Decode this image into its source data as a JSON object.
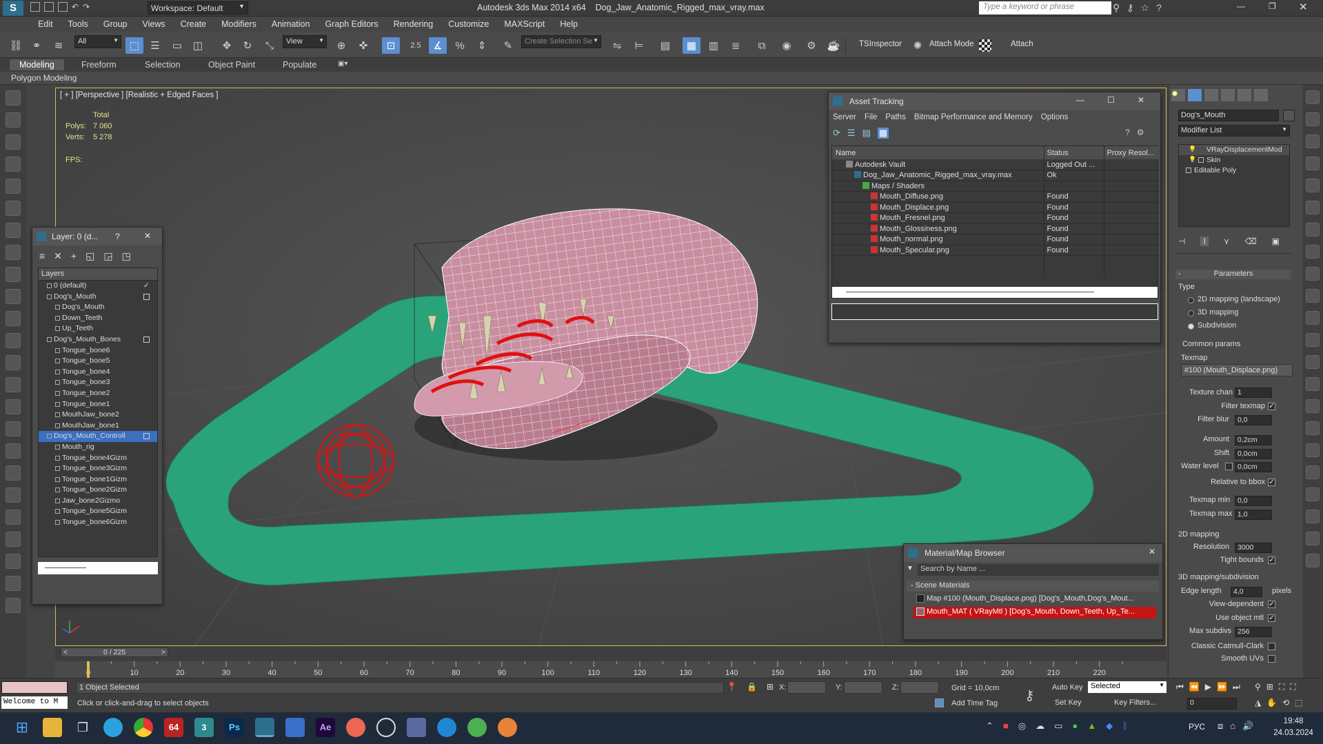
{
  "app": {
    "title": "Autodesk 3ds Max  2014 x64",
    "file": "Dog_Jaw_Anatomic_Rigged_max_vray.max",
    "workspace": "Workspace: Default",
    "search_placeholder": "Type a keyword or phrase"
  },
  "menu": [
    "Edit",
    "Tools",
    "Group",
    "Views",
    "Create",
    "Modifiers",
    "Animation",
    "Graph Editors",
    "Rendering",
    "Customize",
    "MAXScript",
    "Help"
  ],
  "toolbar": {
    "filter": "All",
    "refcoord": "View",
    "snap_value": "2.5",
    "selection_set_placeholder": "Create Selection Se",
    "tsinspector": "TSInspector",
    "attach_mode": "Attach Mode",
    "attach": "Attach"
  },
  "ribbon": {
    "tabs": [
      "Modeling",
      "Freeform",
      "Selection",
      "Object Paint",
      "Populate"
    ],
    "sub": "Polygon Modeling"
  },
  "viewport": {
    "label": "[ + ] [Perspective ] [Realistic + Edged Faces ]",
    "stats_header": "Total",
    "polys_label": "Polys:",
    "polys_value": "7 060",
    "verts_label": "Verts:",
    "verts_value": "5 278",
    "fps_label": "FPS:"
  },
  "layer_window": {
    "title": "Layer: 0 (d...",
    "help": "?",
    "header": "Layers",
    "items": [
      {
        "label": "0 (default)",
        "level": 0
      },
      {
        "label": "Dog's_Mouth",
        "level": 0
      },
      {
        "label": "Dog's_Mouth",
        "level": 1
      },
      {
        "label": "Down_Teeth",
        "level": 1
      },
      {
        "label": "Up_Teeth",
        "level": 1
      },
      {
        "label": "Dog's_Mouth_Bones",
        "level": 0
      },
      {
        "label": "Tongue_bone6",
        "level": 1
      },
      {
        "label": "Tongue_bone5",
        "level": 1
      },
      {
        "label": "Tongue_bone4",
        "level": 1
      },
      {
        "label": "Tongue_bone3",
        "level": 1
      },
      {
        "label": "Tongue_bone2",
        "level": 1
      },
      {
        "label": "Tongue_bone1",
        "level": 1
      },
      {
        "label": "MouthJaw_bone2",
        "level": 1
      },
      {
        "label": "MouthJaw_bone1",
        "level": 1
      },
      {
        "label": "Dog's_Mouth_Controll",
        "level": 0
      },
      {
        "label": "Mouth_rig",
        "level": 1
      },
      {
        "label": "Tongue_bone4Gizm",
        "level": 1
      },
      {
        "label": "Tongue_bone3Gizm",
        "level": 1
      },
      {
        "label": "Tongue_bone1Gizm",
        "level": 1
      },
      {
        "label": "Tongue_bone2Gizm",
        "level": 1
      },
      {
        "label": "Jaw_bone2Gizmo",
        "level": 1
      },
      {
        "label": "Tongue_bone5Gizm",
        "level": 1
      },
      {
        "label": "Tongue_bone6Gizm",
        "level": 1
      }
    ]
  },
  "asset_tracking": {
    "title": "Asset Tracking",
    "menu": [
      "Server",
      "File",
      "Paths",
      "Bitmap Performance and Memory",
      "Options"
    ],
    "columns": [
      "Name",
      "Status",
      "Proxy Resol..."
    ],
    "rows": [
      {
        "name": "Autodesk Vault",
        "status": "Logged Out ...",
        "indent": 1
      },
      {
        "name": "Dog_Jaw_Anatomic_Rigged_max_vray.max",
        "status": "Ok",
        "indent": 2
      },
      {
        "name": "Maps / Shaders",
        "status": "",
        "indent": 3
      },
      {
        "name": "Mouth_Diffuse.png",
        "status": "Found",
        "indent": 4
      },
      {
        "name": "Mouth_Displace.png",
        "status": "Found",
        "indent": 4
      },
      {
        "name": "Mouth_Fresnel.png",
        "status": "Found",
        "indent": 4
      },
      {
        "name": "Mouth_Glossiness.png",
        "status": "Found",
        "indent": 4
      },
      {
        "name": "Mouth_normal.png",
        "status": "Found",
        "indent": 4
      },
      {
        "name": "Mouth_Specular.png",
        "status": "Found",
        "indent": 4
      }
    ]
  },
  "material_browser": {
    "title": "Material/Map Browser",
    "search_placeholder": "Search by Name ...",
    "section": "- Scene Materials",
    "items": [
      "Map #100 (Mouth_Displace.png) [Dog's_Mouth,Dog's_Mout...",
      "Mouth_MAT  ( VRayMtl )  [Dog's_Mouth, Down_Teeth, Up_Te..."
    ]
  },
  "command_panel": {
    "object_name": "Dog's_Mouth",
    "modifier_list": "Modifier List",
    "stack": [
      "VRayDisplacementMod",
      "Skin",
      "Editable Poly"
    ],
    "rollout": "Parameters",
    "type_label": "Type",
    "type_options": [
      "2D mapping (landscape)",
      "3D mapping",
      "Subdivision"
    ],
    "common_params": "Common params",
    "texmap_label": "Texmap",
    "texmap_value": "#100 (Mouth_Displace.png)",
    "texture_chan_label": "Texture chan",
    "texture_chan": "1",
    "filter_texmap": "Filter texmap",
    "filter_blur_label": "Filter blur",
    "filter_blur": "0,0",
    "amount_label": "Amount",
    "amount": "0,2cm",
    "shift_label": "Shift",
    "shift": "0,0cm",
    "water_level_label": "Water level",
    "water_level": "0,0cm",
    "relative_bbox": "Relative to bbox",
    "texmap_min_label": "Texmap min",
    "texmap_min": "0,0",
    "texmap_max_label": "Texmap max",
    "texmap_max": "1,0",
    "mapping2d": "2D mapping",
    "resolution_label": "Resolution",
    "resolution": "3000",
    "tight_bounds": "Tight bounds",
    "mapping3d": "3D mapping/subdivision",
    "edge_length_label": "Edge length",
    "edge_length": "4,0",
    "pixels": "pixels",
    "view_dependent": "View-dependent",
    "use_object_mtl": "Use object mtl",
    "max_subdivs_label": "Max subdivs",
    "max_subdivs": "256",
    "classic_catmull": "Classic Catmull-Clark",
    "smooth_uvs": "Smooth UVs"
  },
  "timeline": {
    "frame": "0 / 225",
    "ticks": [
      "0",
      "10",
      "20",
      "30",
      "40",
      "50",
      "60",
      "70",
      "80",
      "90",
      "100",
      "110",
      "120",
      "130",
      "140",
      "150",
      "160",
      "170",
      "180",
      "190",
      "200",
      "210",
      "220"
    ]
  },
  "status": {
    "listener": "Welcome to M",
    "selected": "1 Object Selected",
    "prompt": "Click or click-and-drag to select objects",
    "x_label": "X:",
    "y_label": "Y:",
    "z_label": "Z:",
    "grid": "Grid = 10,0cm",
    "add_time_tag": "Add Time Tag",
    "auto_key": "Auto Key",
    "set_key": "Set Key",
    "key_mode": "Selected",
    "key_filters": "Key Filters...",
    "frame_value": "0"
  },
  "taskbar": {
    "lang": "РУС",
    "time": "19:48",
    "date": "24.03.2024"
  },
  "colors": {
    "accent": "#5b8fd0",
    "viewport_border": "#d8c05a",
    "rig_green": "#2aa37a",
    "control_red": "#e01010",
    "mesh_pink": "#c98ea0"
  }
}
